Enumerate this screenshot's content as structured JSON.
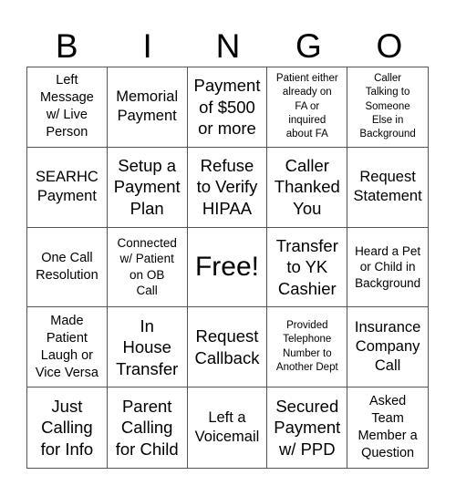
{
  "header": {
    "letters": [
      "B",
      "I",
      "N",
      "G",
      "O"
    ]
  },
  "cells": [
    {
      "text": "Left Message w/ Live Person",
      "lines": [
        "Left",
        "Message",
        "w/ Live",
        "Person"
      ],
      "size": "s14"
    },
    {
      "text": "Memorial Payment",
      "lines": [
        "Memorial",
        "Payment"
      ],
      "size": "s16"
    },
    {
      "text": "Payment of $500 or more",
      "lines": [
        "Payment",
        "of $500",
        "or more"
      ],
      "size": "s18"
    },
    {
      "text": "Patient either already on FA or inquired about FA",
      "lines": [
        "Patient either",
        "already on",
        "FA or",
        "inquired",
        "about FA"
      ],
      "size": "s11"
    },
    {
      "text": "Caller Talking to Someone Else in Background",
      "lines": [
        "Caller",
        "Talking to",
        "Someone",
        "Else in",
        "Background"
      ],
      "size": "s11"
    },
    {
      "text": "SEARHC Payment",
      "lines": [
        "SEARHC",
        "Payment"
      ],
      "size": "s16"
    },
    {
      "text": "Setup a Payment Plan",
      "lines": [
        "Setup a",
        "Payment",
        "Plan"
      ],
      "size": "s18"
    },
    {
      "text": "Refuse to Verify HIPAA",
      "lines": [
        "Refuse",
        "to Verify",
        "HIPAA"
      ],
      "size": "s18"
    },
    {
      "text": "Caller Thanked You",
      "lines": [
        "Caller",
        "Thanked",
        "You"
      ],
      "size": "s18"
    },
    {
      "text": "Request Statement",
      "lines": [
        "Request",
        "Statement"
      ],
      "size": "s16"
    },
    {
      "text": "One Call Resolution",
      "lines": [
        "One Call",
        "Resolution"
      ],
      "size": "s14"
    },
    {
      "text": "Connected w/ Patient on OB Call",
      "lines": [
        "Connected",
        "w/ Patient",
        "on OB",
        "Call"
      ],
      "size": "s13"
    },
    {
      "text": "Free!",
      "lines": [
        "Free!"
      ],
      "size": "s30",
      "free": true
    },
    {
      "text": "Transfer to YK Cashier",
      "lines": [
        "Transfer",
        "to YK",
        "Cashier"
      ],
      "size": "s18"
    },
    {
      "text": "Heard a Pet or Child in Background",
      "lines": [
        "Heard a Pet",
        "or Child in",
        "Background"
      ],
      "size": "s13"
    },
    {
      "text": "Made Patient Laugh or Vice Versa",
      "lines": [
        "Made",
        "Patient",
        "Laugh or",
        "Vice Versa"
      ],
      "size": "s14"
    },
    {
      "text": "In House Transfer",
      "lines": [
        "In",
        "House",
        "Transfer"
      ],
      "size": "s18"
    },
    {
      "text": "Request Callback",
      "lines": [
        "Request",
        "Callback"
      ],
      "size": "s18"
    },
    {
      "text": "Provided Telephone Number to Another Dept",
      "lines": [
        "Provided",
        "Telephone",
        "Number to",
        "Another Dept"
      ],
      "size": "s11"
    },
    {
      "text": "Insurance Company Call",
      "lines": [
        "Insurance",
        "Company",
        "Call"
      ],
      "size": "s16"
    },
    {
      "text": "Just Calling for Info",
      "lines": [
        "Just",
        "Calling",
        "for Info"
      ],
      "size": "s18"
    },
    {
      "text": "Parent Calling for Child",
      "lines": [
        "Parent",
        "Calling",
        "for Child"
      ],
      "size": "s18"
    },
    {
      "text": "Left a Voicemail",
      "lines": [
        "Left a",
        "Voicemail"
      ],
      "size": "s16"
    },
    {
      "text": "Secured Payment w/ PPD",
      "lines": [
        "Secured",
        "Payment",
        "w/ PPD"
      ],
      "size": "s18"
    },
    {
      "text": "Asked Team Member a Question",
      "lines": [
        "Asked",
        "Team",
        "Member a",
        "Question"
      ],
      "size": "s14"
    }
  ]
}
